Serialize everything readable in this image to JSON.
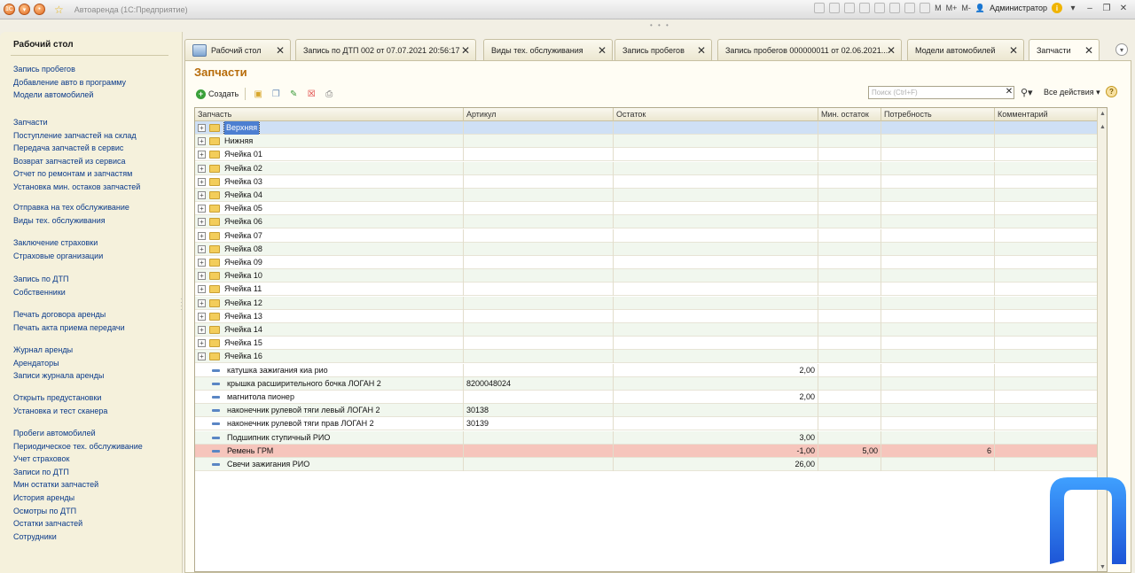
{
  "app": {
    "title": "Автоаренда (1С:Предприятие)",
    "user": "Администратор",
    "memory_buttons": [
      "M",
      "M+",
      "M-"
    ]
  },
  "sidebar": {
    "title": "Рабочий стол",
    "groups": [
      [
        "Запись пробегов",
        "Добавление авто в программу",
        "Модели автомобилей"
      ],
      [
        "Запчасти",
        "Поступление запчастей на склад",
        "Передача запчастей в сервис",
        "Возврат запчастей из сервиса",
        "Отчет по ремонтам и запчастям",
        "Установка мин. остаков запчастей"
      ],
      [
        "Отправка на тех обслуживание",
        "Виды тех. обслуживания"
      ],
      [
        "Заключение страховки",
        "Страховые организации"
      ],
      [
        "Запись по ДТП",
        "Собственники"
      ],
      [
        "Печать договора аренды",
        "Печать акта приема передачи"
      ],
      [
        "Журнал аренды",
        "Арендаторы",
        "Записи журнала аренды"
      ],
      [
        "Открыть предустановки",
        "Установка и тест сканера"
      ],
      [
        "Пробеги автомобилей",
        "Периодическое тех. обслуживание",
        "Учет страховок",
        "Записи по ДТП",
        "Мин остатки запчастей",
        "История аренды",
        "Осмотры по ДТП",
        "Остатки запчастей",
        "Сотрудники"
      ]
    ]
  },
  "tabs": [
    {
      "label": "Рабочий стол",
      "home": true
    },
    {
      "label": "Запись по ДТП 002 от 07.07.2021 20:56:17"
    },
    {
      "label": "Виды тех. обслуживания"
    },
    {
      "label": "Запись пробегов"
    },
    {
      "label": "Запись пробегов 000000011 от 02.06.2021..."
    },
    {
      "label": "Модели автомобилей"
    },
    {
      "label": "Запчасти",
      "active": true
    }
  ],
  "page": {
    "title": "Запчасти",
    "create_label": "Создать",
    "search_placeholder": "Поиск (Ctrl+F)",
    "all_actions_label": "Все действия"
  },
  "table": {
    "columns": [
      "Запчасть",
      "Артикул",
      "Остаток",
      "Мин. остаток",
      "Потребность",
      "Комментарий"
    ],
    "rows": [
      {
        "type": "group",
        "name": "Верхняя",
        "selected": true
      },
      {
        "type": "group",
        "name": "Нижняя"
      },
      {
        "type": "group",
        "name": "Ячейка 01"
      },
      {
        "type": "group",
        "name": "Ячейка 02"
      },
      {
        "type": "group",
        "name": "Ячейка 03"
      },
      {
        "type": "group",
        "name": "Ячейка 04"
      },
      {
        "type": "group",
        "name": "Ячейка 05"
      },
      {
        "type": "group",
        "name": "Ячейка 06"
      },
      {
        "type": "group",
        "name": "Ячейка 07"
      },
      {
        "type": "group",
        "name": "Ячейка 08"
      },
      {
        "type": "group",
        "name": "Ячейка 09"
      },
      {
        "type": "group",
        "name": "Ячейка 10"
      },
      {
        "type": "group",
        "name": "Ячейка 11"
      },
      {
        "type": "group",
        "name": "Ячейка 12"
      },
      {
        "type": "group",
        "name": "Ячейка 13"
      },
      {
        "type": "group",
        "name": "Ячейка 14"
      },
      {
        "type": "group",
        "name": "Ячейка 15"
      },
      {
        "type": "group",
        "name": "Ячейка 16"
      },
      {
        "type": "item",
        "name": "катушка зажигания киа рио",
        "article": "",
        "stock": "2,00",
        "min_stock": "",
        "need": "",
        "comment": ""
      },
      {
        "type": "item",
        "name": "крышка расширительного бочка ЛОГАН 2",
        "article": "8200048024",
        "stock": "",
        "min_stock": "",
        "need": "",
        "comment": ""
      },
      {
        "type": "item",
        "name": "магнитола пионер",
        "article": "",
        "stock": "2,00",
        "min_stock": "",
        "need": "",
        "comment": ""
      },
      {
        "type": "item",
        "name": "наконечник рулевой тяги левый ЛОГАН 2",
        "article": "30138",
        "stock": "",
        "min_stock": "",
        "need": "",
        "comment": ""
      },
      {
        "type": "item",
        "name": "наконечник рулевой тяги прав ЛОГАН 2",
        "article": "30139",
        "stock": "",
        "min_stock": "",
        "need": "",
        "comment": ""
      },
      {
        "type": "item",
        "name": "Подшипник ступичный РИО",
        "article": "",
        "stock": "3,00",
        "min_stock": "",
        "need": "",
        "comment": ""
      },
      {
        "type": "item",
        "name": "Ремень ГРМ",
        "article": "",
        "stock": "-1,00",
        "min_stock": "5,00",
        "need": "6",
        "comment": "",
        "alert": true
      },
      {
        "type": "item",
        "name": "Свечи зажигания РИО",
        "article": "",
        "stock": "26,00",
        "min_stock": "",
        "need": "",
        "comment": ""
      }
    ]
  },
  "colors": {
    "accent_title": "#b76c0a",
    "link": "#0a3a8a",
    "selected_row": "#cfe0f5",
    "alert_row": "#f6c5bc",
    "logo_blue": "#2f7fe8"
  }
}
